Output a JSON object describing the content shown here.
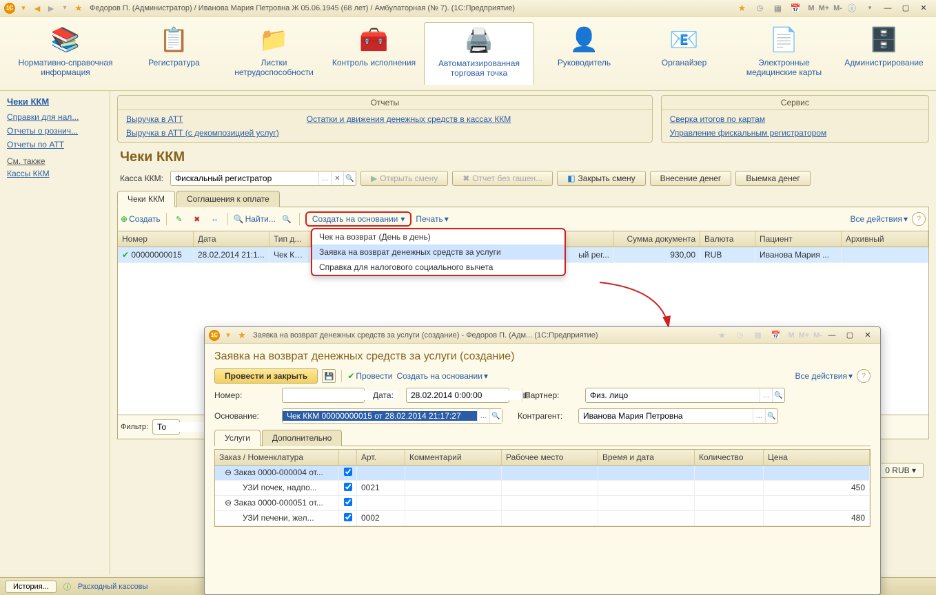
{
  "window": {
    "title": "Федоров П. (Администратор) / Иванова Мария Петровна Ж 05.06.1945 (68 лет) / Амбулаторная (№ 7). (1С:Предприятие)",
    "mem_m": "M",
    "mem_mp": "M+",
    "mem_mm": "M-"
  },
  "mainnav": {
    "items": [
      {
        "label": "Нормативно-справочная информация",
        "icon": "folders"
      },
      {
        "label": "Регистратура",
        "icon": "help-clipboard"
      },
      {
        "label": "Листки нетрудоспособности",
        "icon": "folder"
      },
      {
        "label": "Контроль исполнения",
        "icon": "medkit"
      },
      {
        "label": "Автоматизированная торговая точка",
        "icon": "cash-register"
      },
      {
        "label": "Руководитель",
        "icon": "manager"
      },
      {
        "label": "Органайзер",
        "icon": "organizer"
      },
      {
        "label": "Электронные медицинские карты",
        "icon": "document"
      },
      {
        "label": "Администрирование",
        "icon": "database"
      }
    ],
    "active_index": 4
  },
  "sidebar": {
    "title": "Чеки ККМ",
    "links": [
      "Справки для нал...",
      "Отчеты о рознич...",
      "Отчеты по АТТ"
    ],
    "subheader": "См. также",
    "sublinks": [
      "Кассы ККМ"
    ]
  },
  "panels": {
    "reports": {
      "title": "Отчеты",
      "col1": [
        "Выручка в АТТ",
        "Выручка в АТТ (с декомпозицией услуг)"
      ],
      "col2": [
        "Остатки и движения денежных средств в кассах ККМ"
      ]
    },
    "service": {
      "title": "Сервис",
      "links": [
        "Сверка итогов по картам",
        "Управление фискальным регистратором"
      ]
    }
  },
  "page": {
    "title": "Чеки ККМ",
    "kassa_label": "Касса ККМ:",
    "kassa_value": "Фискальный регистратор",
    "open_shift": "Открыть смену",
    "report_no": "Отчет без гашен...",
    "close_shift": "Закрыть смену",
    "deposit": "Внесение денег",
    "withdraw": "Выемка денег"
  },
  "tabs": {
    "t1": "Чеки ККМ",
    "t2": "Соглашения к оплате"
  },
  "toolbar": {
    "create": "Создать",
    "find": "Найти...",
    "create_based": "Создать на основании",
    "print": "Печать",
    "all_actions": "Все действия"
  },
  "dropdown": {
    "items": [
      "Чек на возврат (День в день)",
      "Заявка на возврат денежных средств за услуги",
      "Справка для налогового социального вычета"
    ],
    "hover_index": 1
  },
  "grid": {
    "headers": [
      "Номер",
      "Дата",
      "Тип д...",
      "",
      "Сумма документа",
      "Валюта",
      "Пациент",
      "Архивный"
    ],
    "row": {
      "number": "00000000015",
      "date": "28.02.2014 21:1...",
      "type": "Чек КК...",
      "kassa_frag": "ый рег...",
      "sum": "930,00",
      "currency": "RUB",
      "patient": "Иванова Мария ..."
    }
  },
  "filter_label": "Фильтр:",
  "filter_value_frag": "То",
  "total_display": "0 RUB",
  "status": {
    "history": "История...",
    "doc_link": "Расходный кассовы"
  },
  "child": {
    "title": "Заявка на возврат денежных средств за услуги (создание) - Федоров П. (Адм...  (1С:Предприятие)",
    "heading": "Заявка на возврат денежных средств за услуги (создание)",
    "post_close": "Провести и закрыть",
    "post": "Провести",
    "create_based": "Создать на основании",
    "all_actions": "Все действия",
    "number_label": "Номер:",
    "date_label": "Дата:",
    "date_value": "28.02.2014 0:00:00",
    "partner_label": "Партнер:",
    "partner_value": "Физ. лицо",
    "basis_label": "Основание:",
    "basis_value": "Чек ККМ 00000000015 от 28.02.2014 21:17:27",
    "contractor_label": "Контрагент:",
    "contractor_value": "Иванова Мария Петровна",
    "tabs": {
      "t1": "Услуги",
      "t2": "Дополнительно"
    },
    "grid": {
      "headers": [
        "Заказ / Номенклатура",
        "",
        "Арт.",
        "Комментарий",
        "Рабочее место",
        "Время и дата",
        "Количество",
        "Цена"
      ],
      "rows": [
        {
          "name": "Заказ 0000-000004 от...",
          "checked": true,
          "art": "",
          "price": "",
          "group": true,
          "sel": true
        },
        {
          "name": "УЗИ почек, надпо...",
          "checked": true,
          "art": "0021",
          "price": "450"
        },
        {
          "name": "Заказ 0000-000051 от...",
          "checked": true,
          "art": "",
          "price": "",
          "group": true
        },
        {
          "name": "УЗИ печени, жел...",
          "checked": true,
          "art": "0002",
          "price": "480"
        }
      ]
    }
  }
}
